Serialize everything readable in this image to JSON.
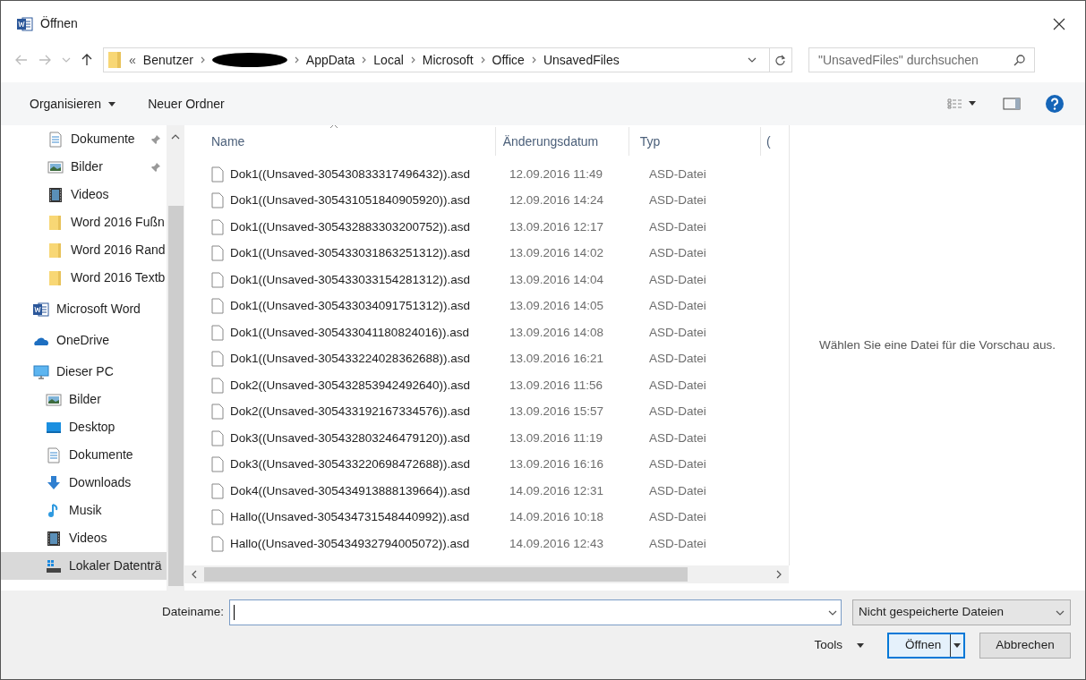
{
  "window": {
    "title": "Öffnen"
  },
  "address": {
    "crumbs_prefix": "«",
    "crumbs": [
      {
        "label": "Benutzer",
        "redacted": false
      },
      {
        "redacted": true
      },
      {
        "label": "AppData",
        "redacted": false
      },
      {
        "label": "Local",
        "redacted": false
      },
      {
        "label": "Microsoft",
        "redacted": false
      },
      {
        "label": "Office",
        "redacted": false
      },
      {
        "label": "UnsavedFiles",
        "redacted": false
      }
    ]
  },
  "search": {
    "placeholder": "\"UnsavedFiles\" durchsuchen"
  },
  "toolbar": {
    "organize": "Organisieren",
    "new_folder": "Neuer Ordner"
  },
  "sidebar": {
    "items": [
      {
        "label": "Dokumente",
        "kind": "doc",
        "pinned": true,
        "selected": false
      },
      {
        "label": "Bilder",
        "kind": "pictures",
        "pinned": true,
        "selected": false
      },
      {
        "label": "Videos",
        "kind": "videos",
        "pinned": false,
        "selected": false
      },
      {
        "label": "Word 2016 Fußn",
        "kind": "folder",
        "selected": false
      },
      {
        "label": "Word 2016 Rand",
        "kind": "folder",
        "selected": false
      },
      {
        "label": "Word 2016 Textb",
        "kind": "folder",
        "selected": false
      },
      {
        "label": "Microsoft Word",
        "kind": "word",
        "root": true,
        "selected": false
      },
      {
        "label": "OneDrive",
        "kind": "cloud",
        "root": true,
        "selected": false
      },
      {
        "label": "Dieser PC",
        "kind": "pc",
        "root": true,
        "selected": false,
        "children": [
          {
            "label": "Bilder",
            "kind": "pictures",
            "selected": false
          },
          {
            "label": "Desktop",
            "kind": "desktop",
            "selected": false
          },
          {
            "label": "Dokumente",
            "kind": "doc",
            "selected": false
          },
          {
            "label": "Downloads",
            "kind": "download",
            "selected": false
          },
          {
            "label": "Musik",
            "kind": "music",
            "selected": false
          },
          {
            "label": "Videos",
            "kind": "videos",
            "selected": false
          },
          {
            "label": "Lokaler Datenträ",
            "kind": "drive",
            "selected": true
          }
        ]
      }
    ]
  },
  "table": {
    "columns": [
      "Name",
      "Änderungsdatum",
      "Typ",
      "("
    ],
    "rows": [
      [
        "Dok1((Unsaved-305430833317496432)).asd",
        "12.09.2016 11:49",
        "ASD-Datei"
      ],
      [
        "Dok1((Unsaved-305431051840905920)).asd",
        "12.09.2016 14:24",
        "ASD-Datei"
      ],
      [
        "Dok1((Unsaved-305432883303200752)).asd",
        "13.09.2016 12:17",
        "ASD-Datei"
      ],
      [
        "Dok1((Unsaved-305433031863251312)).asd",
        "13.09.2016 14:02",
        "ASD-Datei"
      ],
      [
        "Dok1((Unsaved-305433033154281312)).asd",
        "13.09.2016 14:04",
        "ASD-Datei"
      ],
      [
        "Dok1((Unsaved-305433034091751312)).asd",
        "13.09.2016 14:05",
        "ASD-Datei"
      ],
      [
        "Dok1((Unsaved-305433041180824016)).asd",
        "13.09.2016 14:08",
        "ASD-Datei"
      ],
      [
        "Dok1((Unsaved-305433224028362688)).asd",
        "13.09.2016 16:21",
        "ASD-Datei"
      ],
      [
        "Dok2((Unsaved-305432853942492640)).asd",
        "13.09.2016 11:56",
        "ASD-Datei"
      ],
      [
        "Dok2((Unsaved-305433192167334576)).asd",
        "13.09.2016 15:57",
        "ASD-Datei"
      ],
      [
        "Dok3((Unsaved-305432803246479120)).asd",
        "13.09.2016 11:19",
        "ASD-Datei"
      ],
      [
        "Dok3((Unsaved-305433220698472688)).asd",
        "13.09.2016 16:16",
        "ASD-Datei"
      ],
      [
        "Dok4((Unsaved-305434913888139664)).asd",
        "14.09.2016 12:31",
        "ASD-Datei"
      ],
      [
        "Hallo((Unsaved-305434731548440992)).asd",
        "14.09.2016 10:18",
        "ASD-Datei"
      ],
      [
        "Hallo((Unsaved-305434932794005072)).asd",
        "14.09.2016 12:43",
        "ASD-Datei"
      ]
    ]
  },
  "preview": {
    "message": "Wählen Sie eine Datei für die Vorschau aus."
  },
  "footer": {
    "filename_label": "Dateiname:",
    "filter": "Nicht gespeicherte Dateien",
    "tools": "Tools",
    "open": "Öffnen",
    "cancel": "Abbrechen"
  }
}
